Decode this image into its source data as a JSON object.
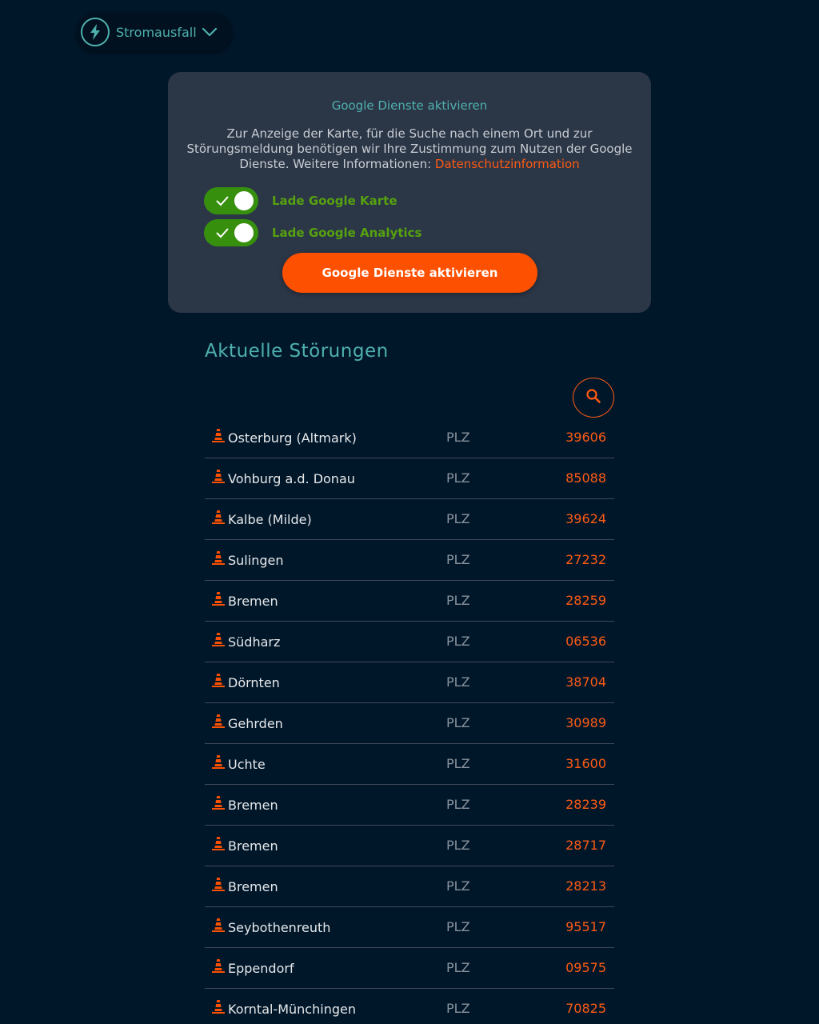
{
  "header": {
    "category_label": "Stromausfall",
    "category_icon": "lightning-bolt-icon",
    "dropdown_icon": "chevron-down-icon"
  },
  "consent": {
    "title": "Google Dienste aktivieren",
    "text": "Zur Anzeige der Karte, für die Suche nach einem Ort und zur Störungsmeldung benötigen wir Ihre Zustimmung zum Nutzen der Google Dienste. Weitere Informationen:",
    "link_label": "Datenschutzinformation",
    "toggles": [
      {
        "label": "Lade Google Karte",
        "checked": true
      },
      {
        "label": "Lade Google Analytics",
        "checked": true
      }
    ],
    "button_label": "Google Dienste aktivieren"
  },
  "outages": {
    "title": "Aktuelle Störungen",
    "search_icon": "search-icon",
    "plz_label": "PLZ",
    "items": [
      {
        "place": "Osterburg (Altmark)",
        "plz": "39606"
      },
      {
        "place": "Vohburg a.d. Donau",
        "plz": "85088"
      },
      {
        "place": "Kalbe (Milde)",
        "plz": "39624"
      },
      {
        "place": "Sulingen",
        "plz": "27232"
      },
      {
        "place": "Bremen",
        "plz": "28259"
      },
      {
        "place": "Südharz",
        "plz": "06536"
      },
      {
        "place": "Dörnten",
        "plz": "38704"
      },
      {
        "place": "Gehrden",
        "plz": "30989"
      },
      {
        "place": "Uchte",
        "plz": "31600"
      },
      {
        "place": "Bremen",
        "plz": "28239"
      },
      {
        "place": "Bremen",
        "plz": "28717"
      },
      {
        "place": "Bremen",
        "plz": "28213"
      },
      {
        "place": "Seybothenreuth",
        "plz": "95517"
      },
      {
        "place": "Eppendorf",
        "plz": "09575"
      },
      {
        "place": "Korntal-Münchingen",
        "plz": "70825"
      }
    ]
  },
  "colors": {
    "background": "#00172a",
    "accent_teal": "#4fb0ae",
    "accent_orange": "#fd5000",
    "toggle_green": "#37900d"
  }
}
